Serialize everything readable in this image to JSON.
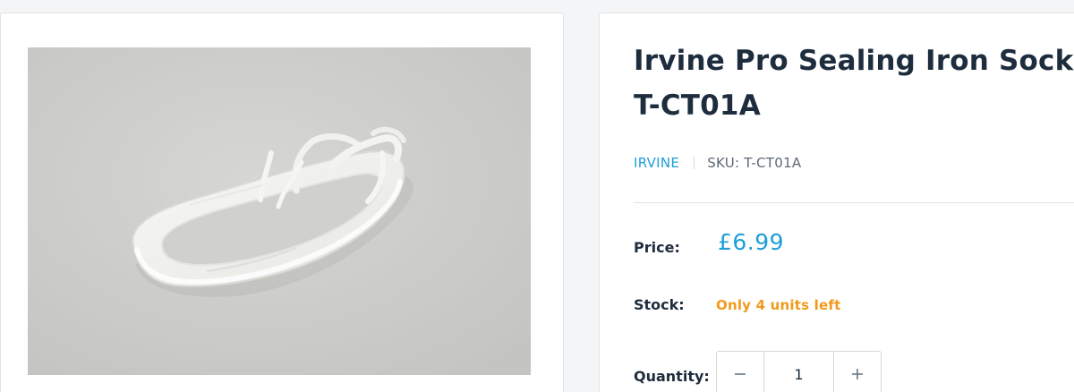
{
  "product": {
    "title": "Irvine Pro Sealing Iron Sock T-CT01A",
    "vendor": "IRVINE",
    "sku_label": "SKU:",
    "sku_value": "T-CT01A",
    "image_alt": "Irvine Pro Sealing Iron Sock"
  },
  "price": {
    "label": "Price:",
    "value": "£6.99"
  },
  "stock": {
    "label": "Stock:",
    "value": "Only 4 units left"
  },
  "quantity": {
    "label": "Quantity:",
    "value": "1",
    "decrease_icon": "minus-icon",
    "increase_icon": "plus-icon"
  },
  "colors": {
    "accent": "#1d9ed8",
    "stock_warning": "#f09a1b",
    "heading": "#1e2d3d"
  }
}
